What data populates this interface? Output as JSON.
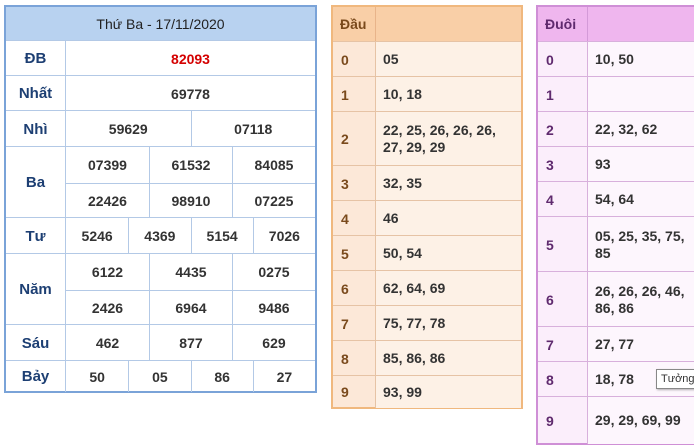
{
  "results": {
    "title": "Thứ Ba - 17/11/2020",
    "rows": [
      {
        "label": "ĐB",
        "values": [
          "82093"
        ]
      },
      {
        "label": "Nhất",
        "values": [
          "69778"
        ]
      },
      {
        "label": "Nhì",
        "values": [
          "59629",
          "07118"
        ]
      },
      {
        "label": "Ba",
        "values": [
          "07399",
          "61532",
          "84085",
          "22426",
          "98910",
          "07225"
        ]
      },
      {
        "label": "Tư",
        "values": [
          "5246",
          "4369",
          "5154",
          "7026"
        ]
      },
      {
        "label": "Năm",
        "values": [
          "6122",
          "4435",
          "0275",
          "2426",
          "6964",
          "9486"
        ]
      },
      {
        "label": "Sáu",
        "values": [
          "462",
          "877",
          "629"
        ]
      },
      {
        "label": "Bảy",
        "values": [
          "50",
          "05",
          "86",
          "27"
        ]
      }
    ]
  },
  "dau": {
    "header": "Đầu",
    "rows": [
      {
        "key": "0",
        "value": "05"
      },
      {
        "key": "1",
        "value": "10, 18"
      },
      {
        "key": "2",
        "value": "22, 25, 26, 26, 26, 27, 29, 29"
      },
      {
        "key": "3",
        "value": "32, 35"
      },
      {
        "key": "4",
        "value": "46"
      },
      {
        "key": "5",
        "value": "50, 54"
      },
      {
        "key": "6",
        "value": "62, 64, 69"
      },
      {
        "key": "7",
        "value": "75, 77, 78"
      },
      {
        "key": "8",
        "value": "85, 86, 86"
      },
      {
        "key": "9",
        "value": "93, 99"
      }
    ]
  },
  "duoi": {
    "header": "Đuôi",
    "rows": [
      {
        "key": "0",
        "value": "10, 50"
      },
      {
        "key": "1",
        "value": ""
      },
      {
        "key": "2",
        "value": "22, 32, 62"
      },
      {
        "key": "3",
        "value": "93"
      },
      {
        "key": "4",
        "value": "54, 64"
      },
      {
        "key": "5",
        "value": "05, 25, 35, 75, 85"
      },
      {
        "key": "6",
        "value": "26, 26, 26, 46, 86, 86"
      },
      {
        "key": "7",
        "value": "27, 77"
      },
      {
        "key": "8",
        "value": "18, 78"
      },
      {
        "key": "9",
        "value": "29, 29, 69, 99"
      }
    ]
  },
  "tooltip": "Tưởng",
  "colors": {
    "special_prize": "#d40000",
    "results_header": "#b8d2f0",
    "dau_header": "#f9cfa7",
    "duoi_header": "#efb6ee"
  }
}
